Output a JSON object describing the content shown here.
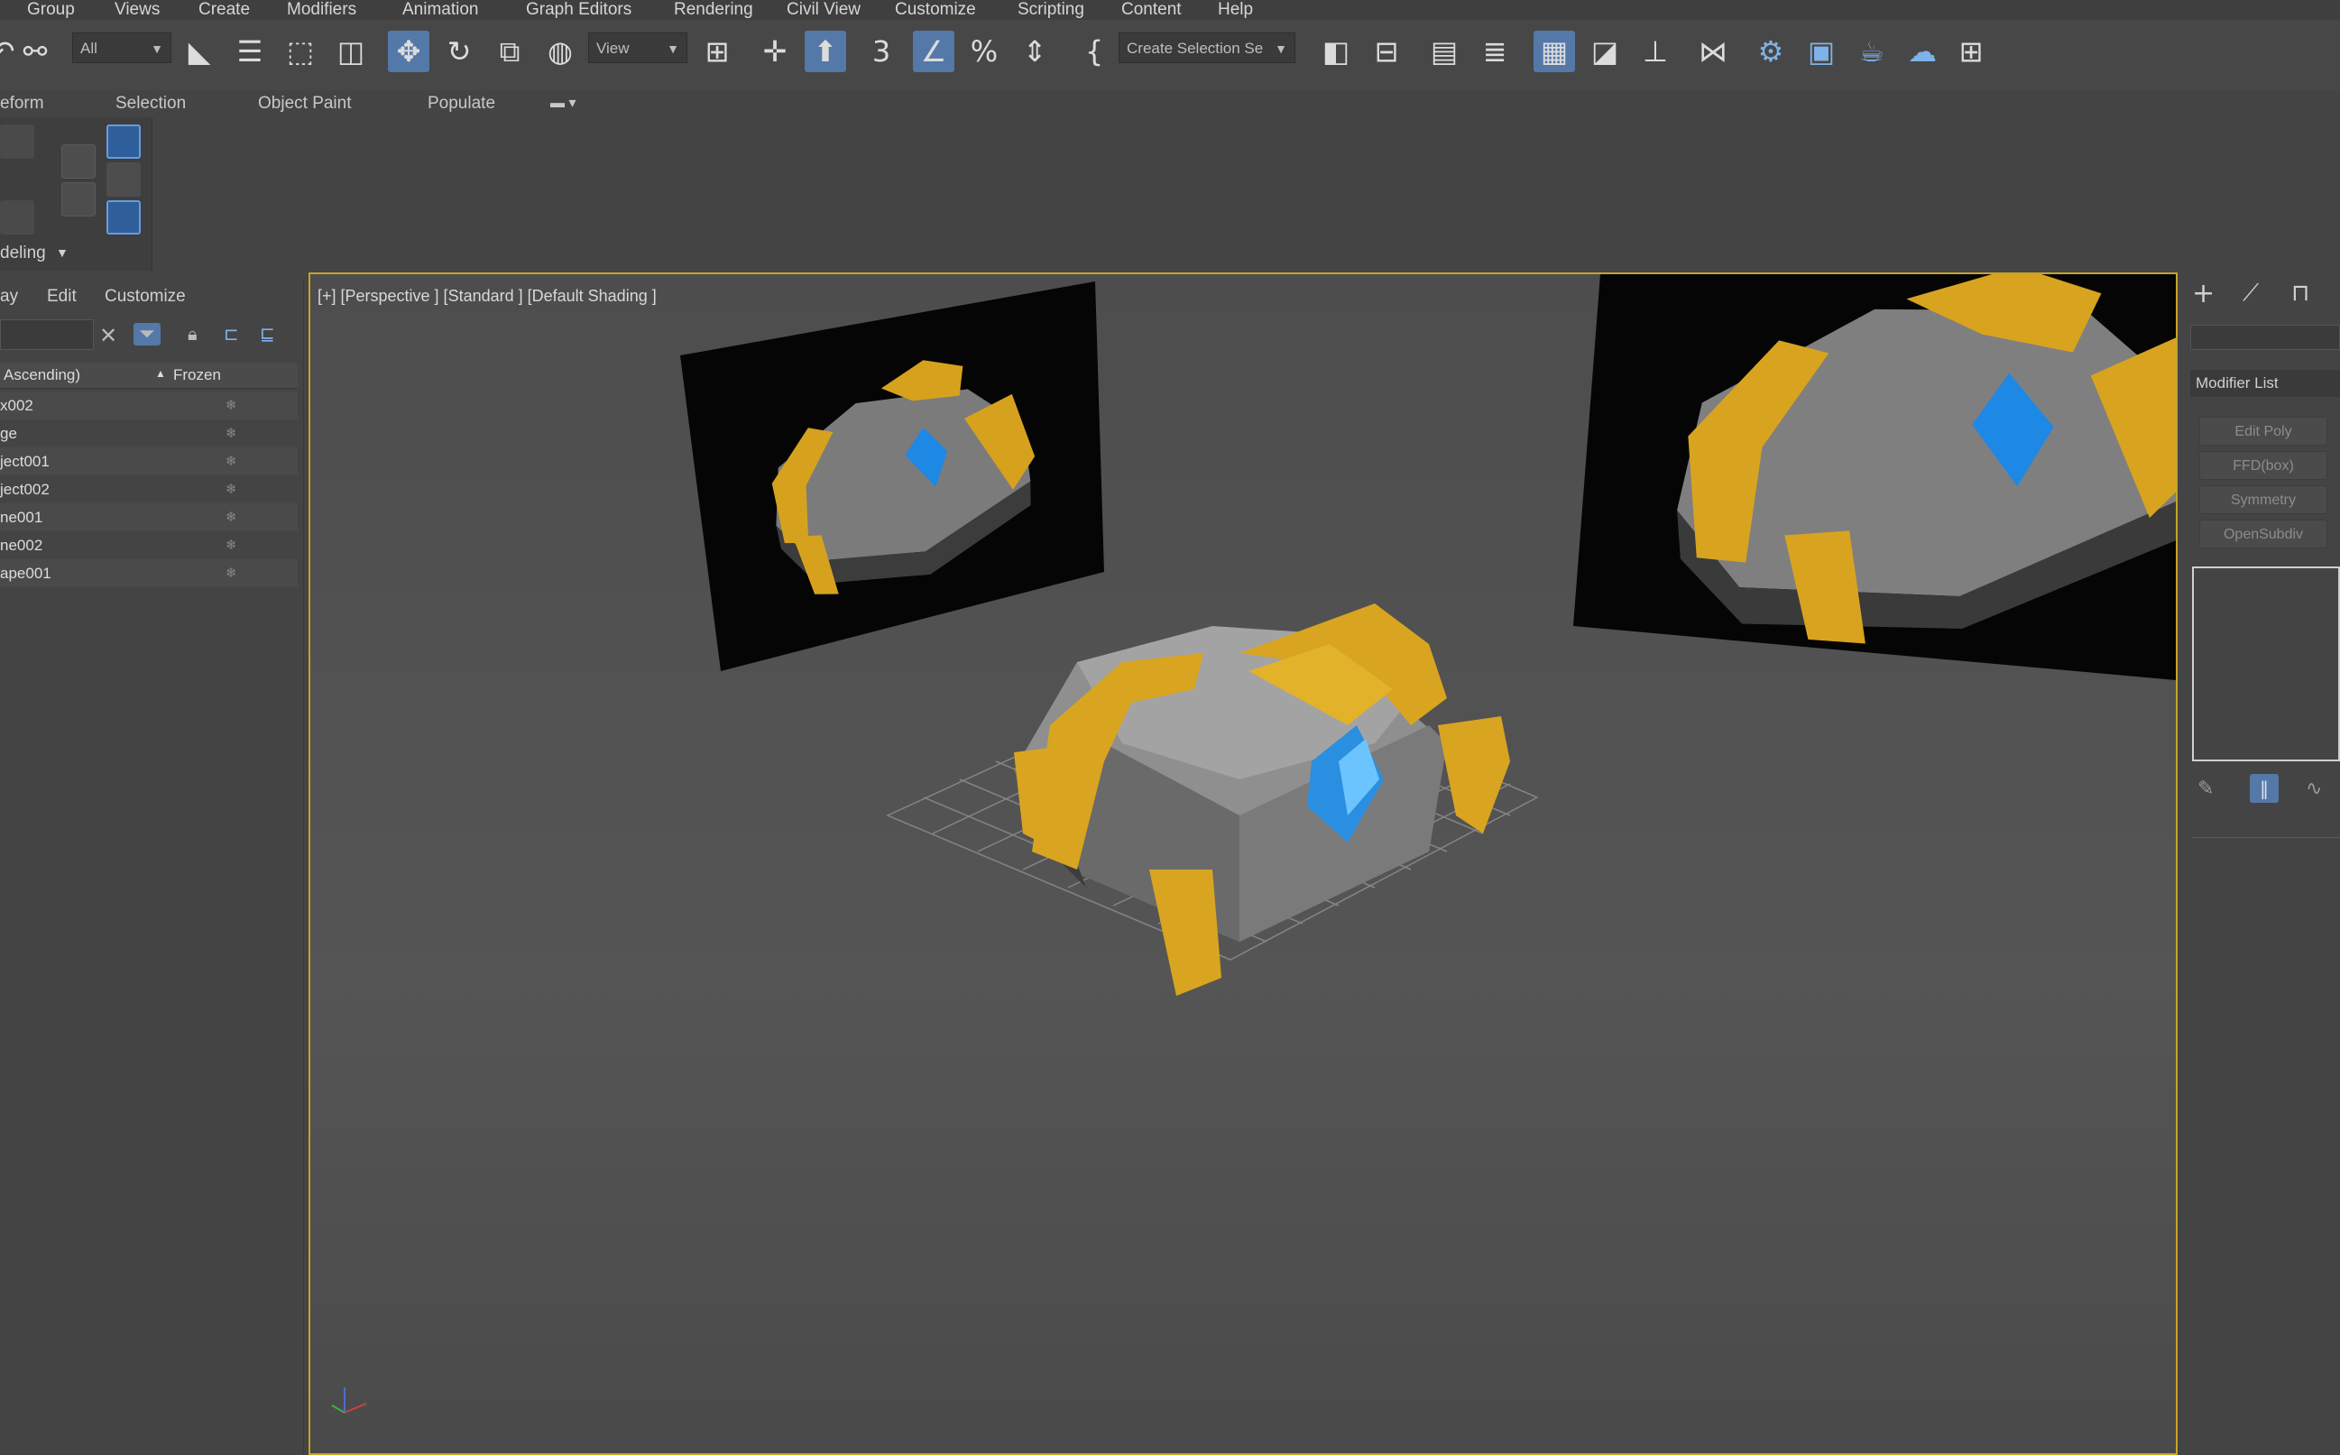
{
  "menu": [
    "Group",
    "Views",
    "Create",
    "Modifiers",
    "Animation",
    "Graph Editors",
    "Rendering",
    "Civil View",
    "Customize",
    "Scripting",
    "Content",
    "Help"
  ],
  "toolbar": {
    "filter_value": "All",
    "view_value": "View",
    "selection_set_value": "Create Selection Se",
    "icons": [
      "undo-icon",
      "link-icon",
      "select-object-icon",
      "select-by-name-icon",
      "rect-region-icon",
      "window-crossing-icon",
      "move-icon",
      "rotate-icon",
      "scale-icon",
      "select-manipulate-icon",
      "view-pick-icon",
      "pivot-icon",
      "keyboard-shortcut-icon",
      "snap-3d-icon",
      "angle-snap-icon",
      "percent-snap-icon",
      "spinner-snap-icon",
      "named-sets-icon",
      "mirror-icon",
      "align-icon",
      "scene-explorer-icon",
      "layer-explorer-icon",
      "toggle-ribbon-icon",
      "curve-editor-icon",
      "schematic-view-icon",
      "material-editor-icon",
      "render-setup-icon",
      "rendered-frame-icon",
      "render-icon",
      "render-in-cloud-icon"
    ]
  },
  "ribbon": {
    "tabs": [
      "eform",
      "Selection",
      "Object Paint",
      "Populate"
    ],
    "panel_label": "deling"
  },
  "explorer": {
    "menus": [
      "ay",
      "Edit",
      "Customize"
    ],
    "columns": {
      "name": "Ascending)",
      "frozen": "Frozen"
    },
    "rows": [
      "x002",
      "ge",
      "ject001",
      "ject002",
      "ne001",
      "ne002",
      "ape001"
    ]
  },
  "viewport": {
    "label": "[+] [Perspective ] [Standard ] [Default Shading ]"
  },
  "command_panel": {
    "tabs": [
      "create-icon",
      "modify-icon",
      "hierarchy-icon"
    ],
    "modifier_list_label": "Modifier List",
    "stack": [
      "Edit Poly",
      "FFD(box)",
      "Symmetry",
      "OpenSubdiv"
    ]
  },
  "colors": {
    "accent": "#5478a8",
    "viewport_border": "#c8a22a",
    "chest_gold": "#d9a520",
    "chest_stone": "#8d8d8d",
    "gem_blue": "#2a8fe0"
  }
}
